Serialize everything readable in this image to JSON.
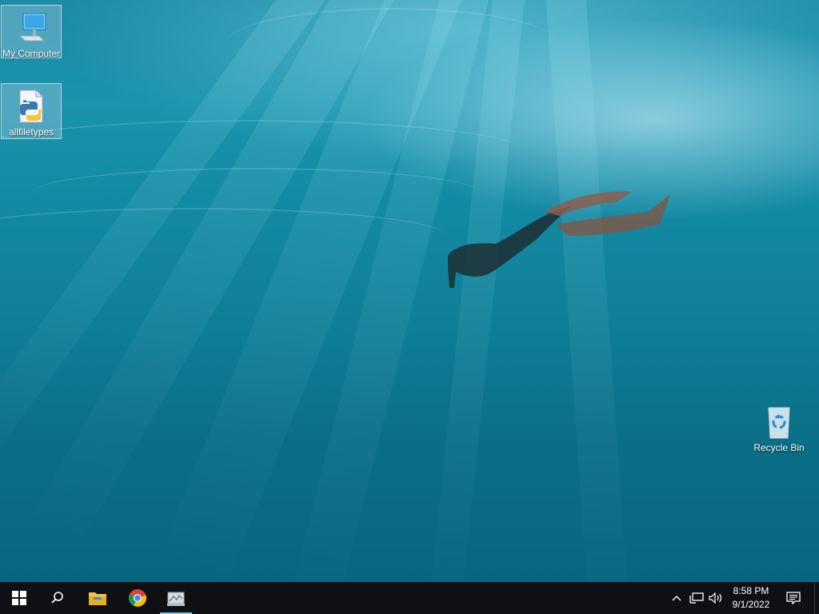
{
  "desktop": {
    "icons": [
      {
        "label": "My Computer",
        "icon": "computer-icon"
      },
      {
        "label": "allfiletypes",
        "icon": "python-file-icon"
      },
      {
        "label": "Recycle Bin",
        "icon": "recycle-bin-icon"
      }
    ],
    "wallpaper": "underwater-freediver"
  },
  "taskbar": {
    "start_icon": "windows-logo-icon",
    "search_icon": "search-icon",
    "pinned": [
      {
        "icon": "file-explorer-icon"
      },
      {
        "icon": "chrome-icon"
      },
      {
        "icon": "app-window-icon",
        "active": true
      }
    ],
    "tray": {
      "chevron_icon": "chevron-up-icon",
      "network_icon": "network-icon",
      "volume_icon": "volume-icon",
      "notification_icon": "notification-icon"
    },
    "clock": {
      "time": "8:58 PM",
      "date": "9/1/2022"
    }
  },
  "colors": {
    "taskbar": "#0f1013",
    "accent": "#78c4ea"
  }
}
